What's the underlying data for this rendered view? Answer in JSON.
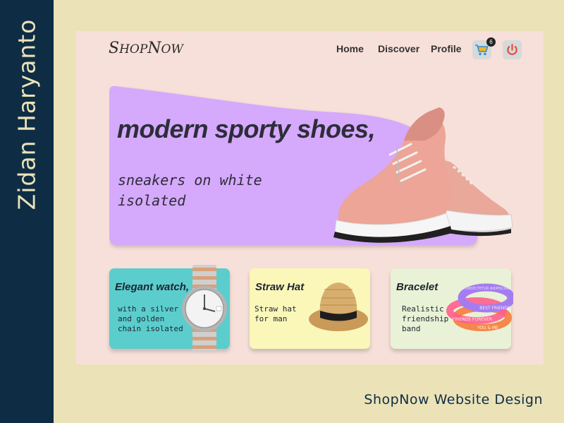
{
  "author_name": "Zidan Haryanto",
  "caption": "ShopNow Website Design",
  "colors": {
    "sidebar": "#0e2d45",
    "page_bg": "#ebe2b8",
    "panel_bg": "#f7e0d9",
    "hero_bg": "#d5a9fb",
    "watch_card": "#5ccdcd",
    "hat_card": "#fbf7b9",
    "bracelet_card": "#e9f2d6"
  },
  "header": {
    "logo_first": "S",
    "logo_rest": "HOP",
    "logo_second": "N",
    "logo_second_rest": "OW",
    "nav": [
      "Home",
      "Discover",
      "Profile"
    ],
    "cart_count": "6",
    "cart_icon": "shopping-cart-icon",
    "power_icon": "power-icon"
  },
  "hero": {
    "title": "modern sporty shoes,",
    "subtitle": "sneakers on white isolated"
  },
  "cards": [
    {
      "title": "Elegant watch,",
      "description": "with a silver and golden chain isolated"
    },
    {
      "title": "Straw Hat",
      "description": "Straw hat for man"
    },
    {
      "title": "Bracelet",
      "description": "Realistic friendship band"
    }
  ],
  "bracelet_texts": [
    "BEST FRIENDS",
    "FRIENDS FOREVER",
    "YOU & ME",
    "CONSECTETUR ADIPISCING"
  ]
}
